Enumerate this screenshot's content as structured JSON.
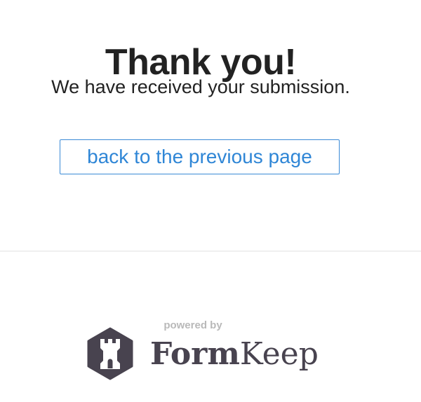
{
  "page": {
    "title": "Thank you!",
    "subtitle": "We have received your submission."
  },
  "actions": {
    "back_label": "back to the previous page"
  },
  "footer": {
    "powered_by": "powered by",
    "brand_part_1": "Form",
    "brand_part_2": "Keep",
    "brand_icon": "rook-tower-icon",
    "brand_color": "#48434f"
  },
  "colors": {
    "accent": "#2f86d6",
    "text": "#222222",
    "muted": "#b9b9b9",
    "divider": "#e2e2e2"
  }
}
